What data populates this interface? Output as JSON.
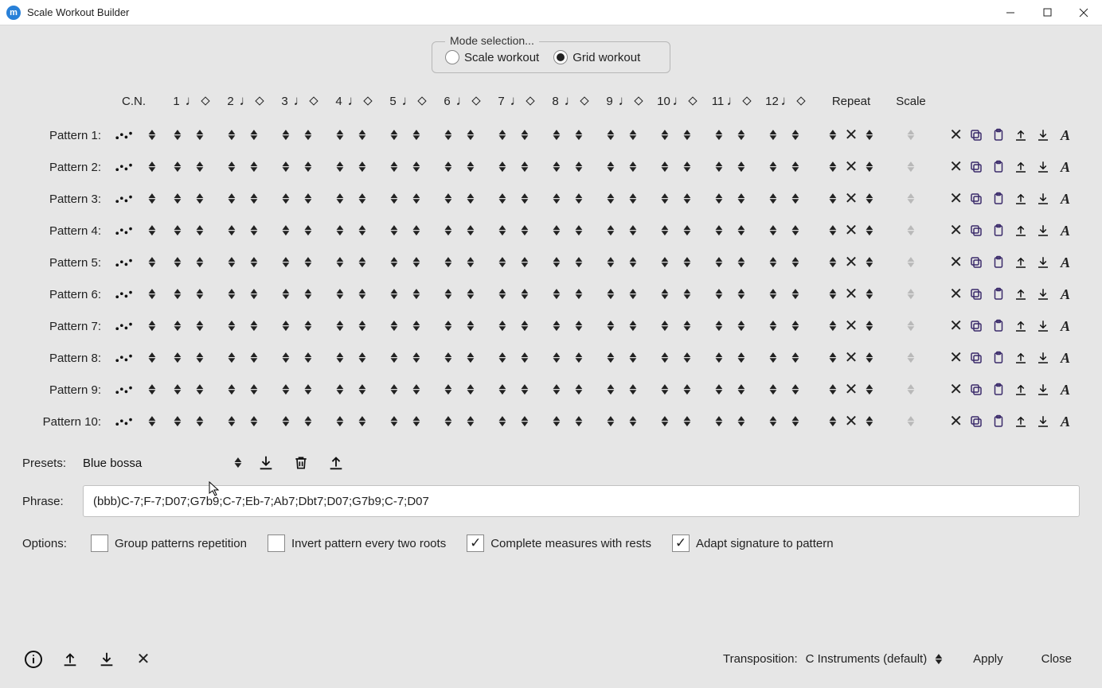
{
  "window": {
    "title": "Scale Workout Builder",
    "icon_initials": "m"
  },
  "mode": {
    "legend": "Mode selection...",
    "opt_scale": "Scale workout",
    "opt_grid": "Grid workout",
    "selected": "grid"
  },
  "headers": {
    "cn": "C.N.",
    "repeat": "Repeat",
    "scale": "Scale"
  },
  "columns": [
    "1",
    "2",
    "3",
    "4",
    "5",
    "6",
    "7",
    "8",
    "9",
    "10",
    "11",
    "12"
  ],
  "patterns": [
    {
      "label": "Pattern 1:"
    },
    {
      "label": "Pattern 2:"
    },
    {
      "label": "Pattern 3:"
    },
    {
      "label": "Pattern 4:"
    },
    {
      "label": "Pattern 5:"
    },
    {
      "label": "Pattern 6:"
    },
    {
      "label": "Pattern 7:"
    },
    {
      "label": "Pattern 8:"
    },
    {
      "label": "Pattern 9:"
    },
    {
      "label": "Pattern 10:"
    }
  ],
  "row_action_icons": {
    "clear": "clear-icon",
    "copy": "copy-icon",
    "paste": "paste-icon",
    "export": "upload-icon",
    "import": "download-icon",
    "articulation": "script-a-icon"
  },
  "presets": {
    "label": "Presets:",
    "value": "Blue bossa"
  },
  "phrase": {
    "label": "Phrase:",
    "value": "(bbb)C-7;F-7;D07;G7b9;C-7;Eb-7;Ab7;Dbt7;D07;G7b9;C-7;D07"
  },
  "options": {
    "label": "Options:",
    "group": {
      "label": "Group patterns repetition",
      "checked": false
    },
    "invert": {
      "label": "Invert pattern every two roots",
      "checked": false
    },
    "complete": {
      "label": "Complete measures with rests",
      "checked": true
    },
    "adapt": {
      "label": "Adapt signature to pattern",
      "checked": true
    }
  },
  "bottom": {
    "transposition_label": "Transposition:",
    "transposition_value": "C Instruments (default)",
    "apply": "Apply",
    "close": "Close"
  }
}
